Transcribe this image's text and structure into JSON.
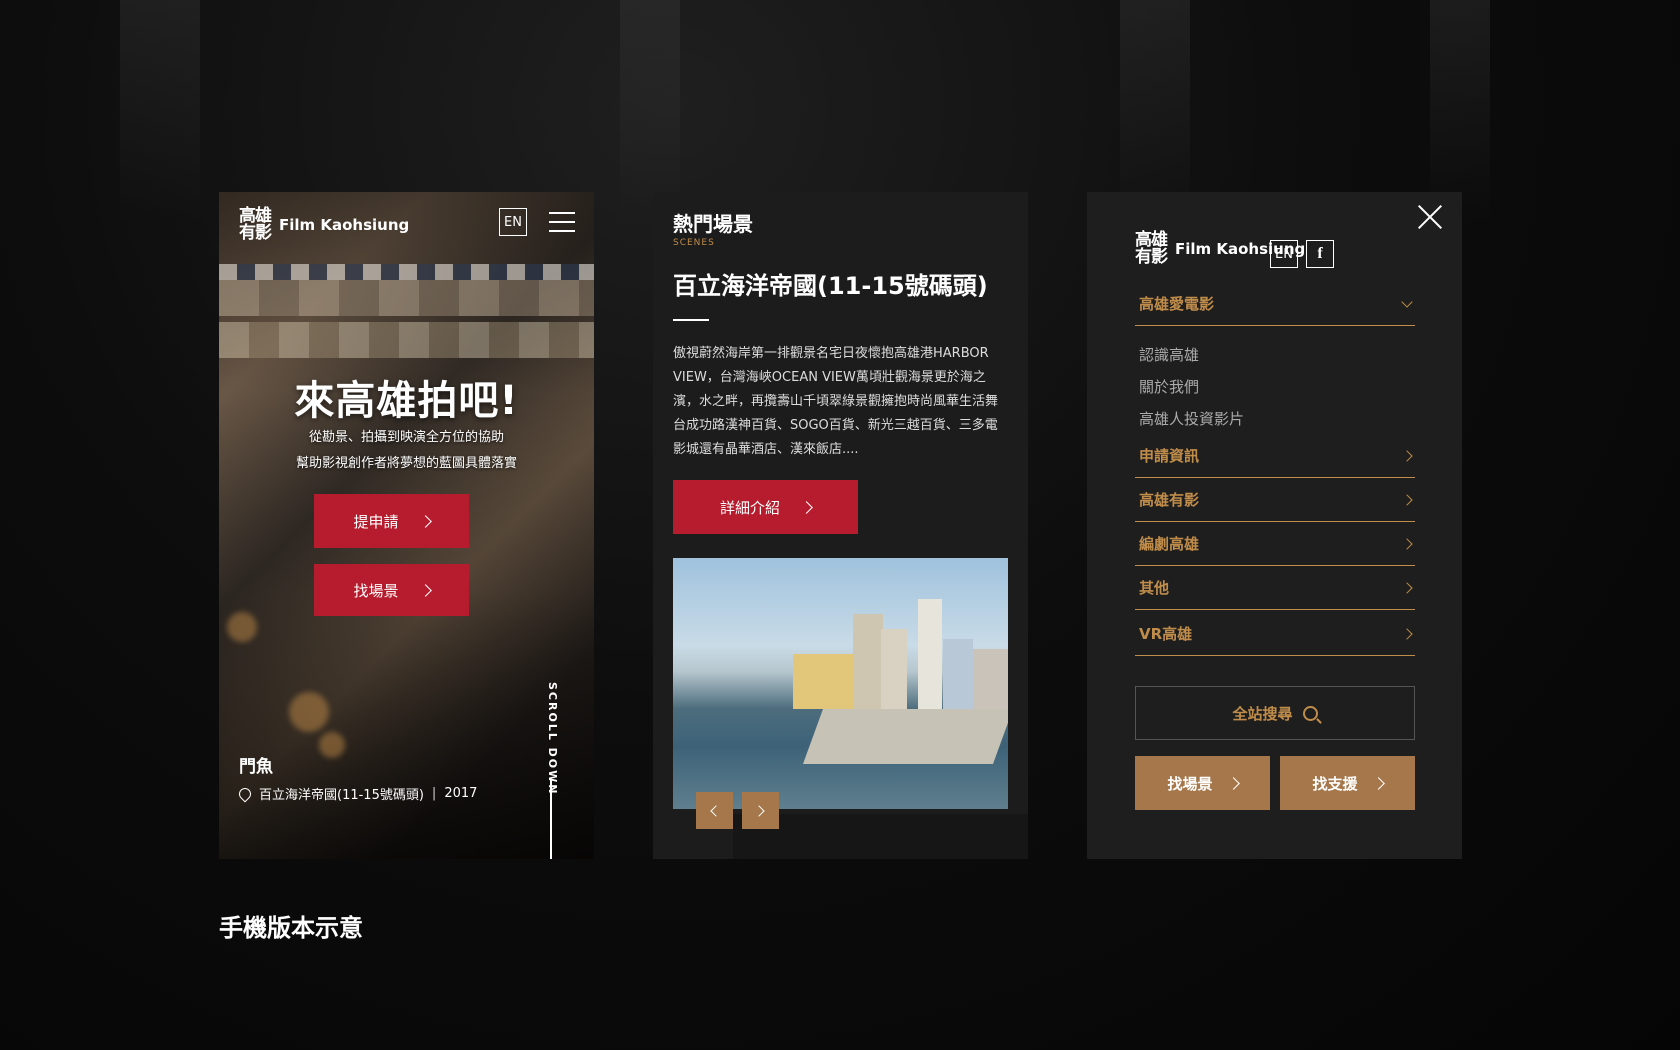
{
  "home": {
    "logo_zh": "高雄有影",
    "logo_en": "Film Kaohsiung",
    "lang": "EN",
    "hero_title": "來高雄拍吧!",
    "hero_line1": "從勘景、拍攝到映演全方位的協助",
    "hero_line2": "幫助影視創作者將夢想的藍圖具體落實",
    "btn_apply": "提申請",
    "btn_find_scene": "找場景",
    "scroll_label": "SCROLL DOWN",
    "film_title": "門魚",
    "film_location": "百立海洋帝國(11-15號碼頭)",
    "film_year": "2017"
  },
  "scenes": {
    "section_title": "熱門場景",
    "section_sub": "SCENES",
    "scene_title": "百立海洋帝國(11-15號碼頭)",
    "description": "傲視蔚然海岸第一排觀景名宅日夜懷抱高雄港HARBOR VIEW，台灣海峽OCEAN VIEW萬頃壯觀海景更於海之濱，水之畔，再攬壽山千頃翠綠景觀擁抱時尚風華生活舞台成功路漢神百貨、SOGO百貨、新光三越百貨、三多電影城還有晶華酒店、漢來飯店....",
    "btn_detail": "詳細介紹"
  },
  "menu": {
    "logo_zh": "高雄有影",
    "logo_en": "Film Kaohsiung",
    "lang": "EN",
    "fb": "f",
    "items": [
      {
        "label": "高雄愛電影"
      },
      {
        "label": "申請資訊"
      },
      {
        "label": "高雄有影"
      },
      {
        "label": "編劇高雄"
      },
      {
        "label": "其他"
      },
      {
        "label": "VR高雄"
      }
    ],
    "sub_items": [
      "認識高雄",
      "關於我們",
      "高雄人投資影片"
    ],
    "search_label": "全站搜尋",
    "btn_find_scene": "找場景",
    "btn_find_support": "找支援"
  },
  "caption": "手機版本示意",
  "colors": {
    "red": "#b71c2e",
    "gold": "#c08c4a",
    "gold_fill": "#a5774a",
    "panel": "#1e1e1e"
  },
  "icons": [
    "hamburger-icon",
    "chevron-right-icon",
    "chevron-left-icon",
    "chevron-down-icon",
    "location-pin-icon",
    "close-icon",
    "search-icon",
    "facebook-icon"
  ]
}
